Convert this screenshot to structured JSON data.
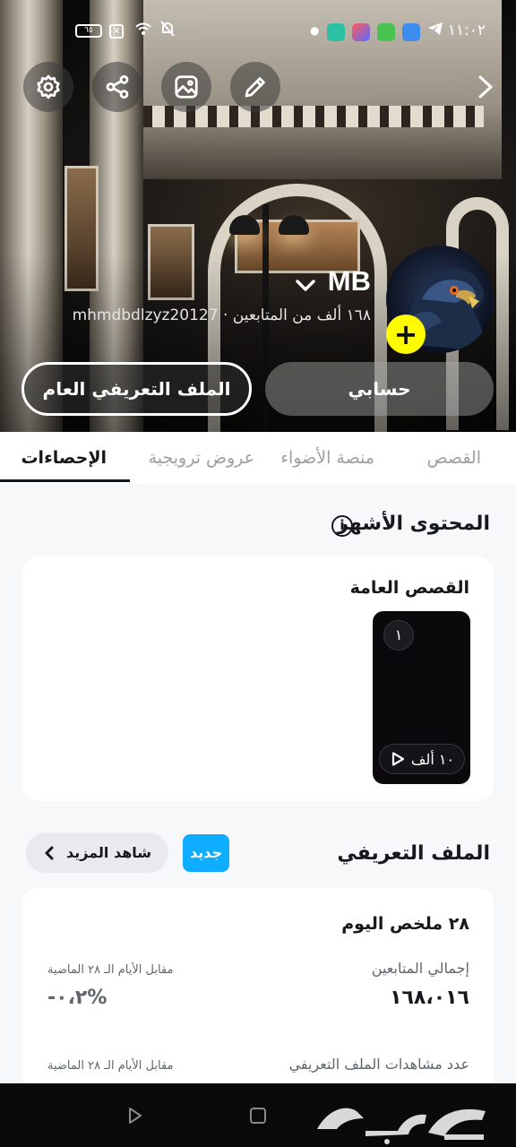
{
  "status_bar": {
    "time": "١١:٠٢",
    "battery": "٦٥"
  },
  "profile": {
    "display_name": "MB",
    "username": "mhmdbdlzyz20127",
    "followers_text": "١٦٨ ألف من المتابعين",
    "separator": "·"
  },
  "buttons": {
    "public_profile": "الملف التعريفي العام",
    "account": "حسابي"
  },
  "tabs": [
    {
      "label": "القصص"
    },
    {
      "label": "منصة الأضواء"
    },
    {
      "label": "عروض ترويجية"
    },
    {
      "label": "الإحصاءات"
    }
  ],
  "top_content": {
    "title": "المحتوى الأشهر",
    "info_icon": "i",
    "card_title": "القصص العامة",
    "story": {
      "rank": "١",
      "views": "١٠ ألف"
    }
  },
  "profile_section": {
    "title": "الملف التعريفي",
    "badge": "جديد",
    "see_more": "شاهد المزيد"
  },
  "summary": {
    "title": "٢٨ ملخص اليوم",
    "followers_label": "إجمالي المتابعين",
    "followers_value": "١٦٨،٠١٦",
    "followers_compare_label": "مقابل الأيام الـ ٢٨ الماضية",
    "followers_compare_value": "%٠،٢-",
    "views_label": "عدد مشاهدات الملف التعريفي",
    "views_compare_label": "مقابل الأيام الـ ٢٨ الماضية"
  },
  "watermark": "حراج",
  "colors": {
    "accent_yellow": "#fffc00",
    "badge_blue": "#0fadff",
    "text_dark": "#16191c",
    "text_muted": "#9ba0a6"
  },
  "icons": [
    "settings-icon",
    "share-icon",
    "image-icon",
    "edit-icon",
    "chevron-right-icon",
    "chevron-down-icon",
    "plus-icon",
    "info-icon",
    "play-icon",
    "chevron-left-icon"
  ]
}
